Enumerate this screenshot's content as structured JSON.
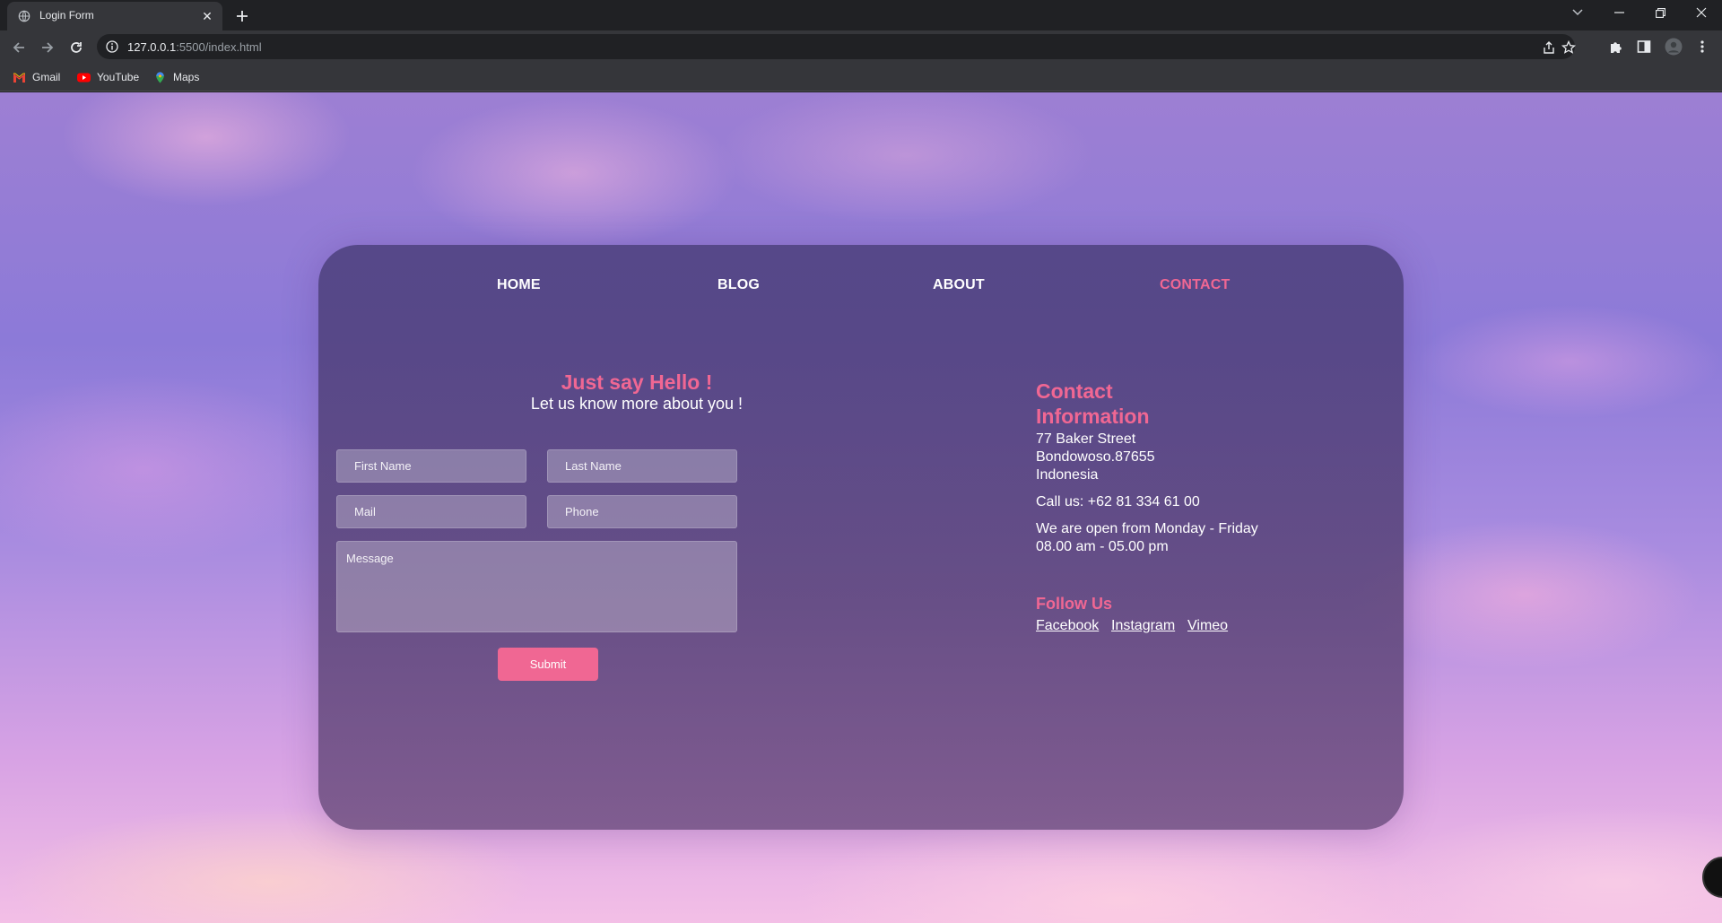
{
  "browser": {
    "tab_title": "Login Form",
    "url_host": "127.0.0.1",
    "url_rest": ":5500/index.html",
    "bookmarks": [
      {
        "label": "Gmail",
        "icon": "gmail-icon"
      },
      {
        "label": "YouTube",
        "icon": "youtube-icon"
      },
      {
        "label": "Maps",
        "icon": "maps-icon"
      }
    ]
  },
  "nav": {
    "home": "HOME",
    "blog": "BLOG",
    "about": "ABOUT",
    "contact": "CONTACT"
  },
  "form": {
    "title": "Just say Hello !",
    "subtitle": "Let us know more about you !",
    "first_name_placeholder": "First Name",
    "last_name_placeholder": "Last Name",
    "mail_placeholder": "Mail",
    "phone_placeholder": "Phone",
    "message_placeholder": "Message",
    "submit_label": "Submit"
  },
  "contact_info": {
    "title": "Contact Information",
    "address_line1": "77 Baker Street",
    "address_line2": "Bondowoso.87655",
    "address_line3": "Indonesia",
    "phone": "Call us: +62 81 334 61 00",
    "hours_line1": "We are open from Monday - Friday",
    "hours_line2": "08.00 am - 05.00 pm",
    "follow_title": "Follow Us",
    "social": [
      "Facebook",
      "Instagram",
      "Vimeo"
    ]
  },
  "colors": {
    "accent": "#f06793",
    "text": "#ffffff",
    "chrome_dark": "#202124",
    "chrome_toolbar": "#35363a"
  }
}
